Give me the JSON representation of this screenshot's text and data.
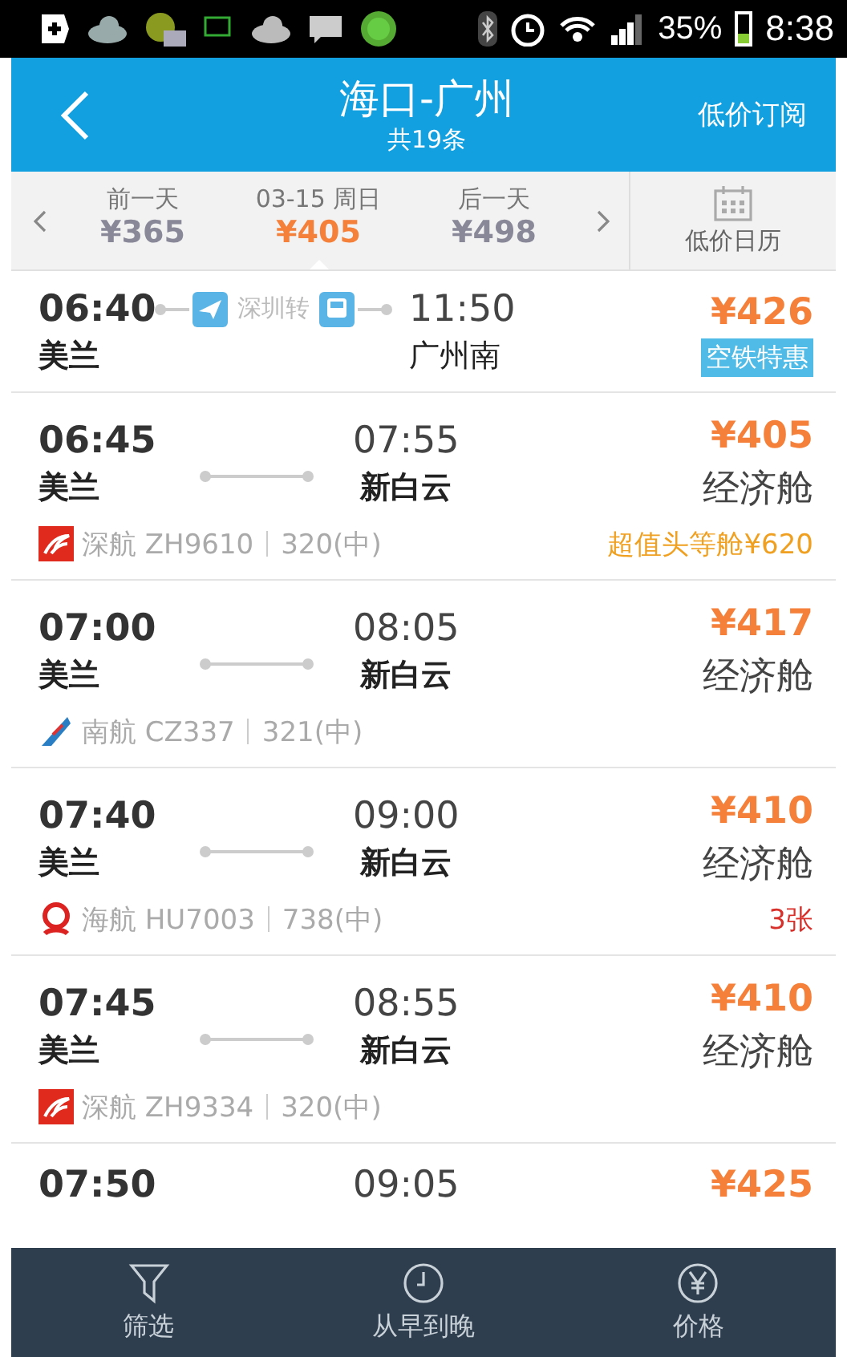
{
  "status_bar": {
    "battery": "35%",
    "time": "8:38"
  },
  "header": {
    "title": "海口-广州",
    "subtitle": "共19条",
    "action": "低价订阅"
  },
  "dates": [
    {
      "label": "前一天",
      "price": "¥365",
      "selected": false
    },
    {
      "label": "03-15 周日",
      "price": "¥405",
      "selected": true
    },
    {
      "label": "后一天",
      "price": "¥498",
      "selected": false
    }
  ],
  "calendar": {
    "label": "低价日历"
  },
  "flights": [
    {
      "kind": "transfer",
      "depart": "06:40",
      "from": "美兰",
      "via": "深圳转",
      "arrive": "11:50",
      "to": "广州南",
      "price": "¥426",
      "badge": "空铁特惠"
    },
    {
      "kind": "direct",
      "depart": "06:45",
      "from": "美兰",
      "arrive": "07:55",
      "to": "新白云",
      "price": "¥405",
      "cabin": "经济舱",
      "airline": {
        "kind": "bird",
        "text": "深航 ZH9610"
      },
      "plane": "320(中)",
      "note": {
        "kind": "offer",
        "text": "超值头等舱¥620"
      }
    },
    {
      "kind": "direct",
      "depart": "07:00",
      "from": "美兰",
      "arrive": "08:05",
      "to": "新白云",
      "price": "¥417",
      "cabin": "经济舱",
      "airline": {
        "kind": "tail",
        "text": "南航 CZ337"
      },
      "plane": "321(中)"
    },
    {
      "kind": "direct",
      "depart": "07:40",
      "from": "美兰",
      "arrive": "09:00",
      "to": "新白云",
      "price": "¥410",
      "cabin": "经济舱",
      "airline": {
        "kind": "flame",
        "text": "海航 HU7003"
      },
      "plane": "738(中)",
      "note": {
        "kind": "remaining",
        "text": "3张"
      }
    },
    {
      "kind": "direct",
      "depart": "07:45",
      "from": "美兰",
      "arrive": "08:55",
      "to": "新白云",
      "price": "¥410",
      "cabin": "经济舱",
      "airline": {
        "kind": "bird",
        "text": "深航 ZH9334"
      },
      "plane": "320(中)"
    },
    {
      "kind": "direct",
      "depart": "07:50",
      "arrive": "09:05",
      "price": "¥425"
    }
  ],
  "tabbar": [
    {
      "label": "筛选"
    },
    {
      "label": "从早到晚"
    },
    {
      "label": "价格"
    }
  ]
}
